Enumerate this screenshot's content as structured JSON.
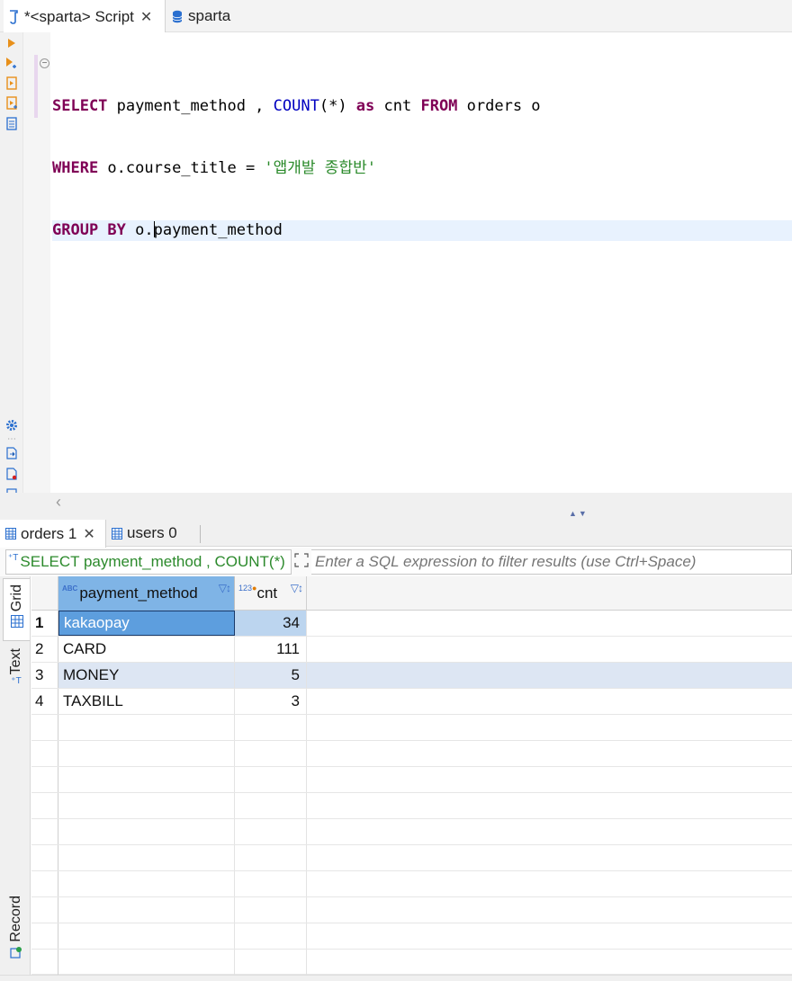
{
  "editor_tabs": [
    {
      "label": "*<sparta> Script",
      "icon": "sql-script-icon",
      "active": true
    },
    {
      "label": "sparta",
      "icon": "database-icon",
      "active": false
    }
  ],
  "code_lines": {
    "l1": {
      "kw1": "SELECT",
      "t1": " payment_method , ",
      "fn1": "COUNT",
      "t2": "(*) ",
      "kw2": "as",
      "t3": " cnt ",
      "kw3": "FROM",
      "t4": " orders o"
    },
    "l2": {
      "kw1": "WHERE",
      "t1": " o.course_title = ",
      "str1": "'앱개발 종합반'"
    },
    "l3": {
      "kw1": "GROUP BY",
      "t1": " o.",
      "t2": "payment_method"
    }
  },
  "result_tabs": [
    {
      "label": "orders 1",
      "closable": true
    },
    {
      "label": "users 0",
      "closable": false
    }
  ],
  "filter": {
    "query_label": "SELECT payment_method , COUNT(*)",
    "placeholder": "Enter a SQL expression to filter results (use Ctrl+Space)"
  },
  "view_tabs": {
    "grid": "Grid",
    "text": "Text",
    "record": "Record"
  },
  "grid": {
    "columns": [
      {
        "name": "payment_method",
        "type_icon": "ABC"
      },
      {
        "name": "cnt",
        "type_icon": "123"
      }
    ],
    "rows": [
      {
        "num": "1",
        "payment_method": "kakaopay",
        "cnt": "34"
      },
      {
        "num": "2",
        "payment_method": "CARD",
        "cnt": "111"
      },
      {
        "num": "3",
        "payment_method": "MONEY",
        "cnt": "5"
      },
      {
        "num": "4",
        "payment_method": "TAXBILL",
        "cnt": "3"
      }
    ]
  },
  "colors": {
    "keyword": "#7f0055",
    "function": "#0000c0",
    "string": "#2a8a2a",
    "selected_header": "#7fb4e6",
    "selected_cell": "#5d9ede"
  }
}
